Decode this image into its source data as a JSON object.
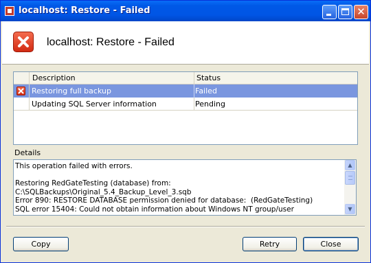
{
  "window": {
    "title": "localhost: Restore - Failed",
    "icon": "app-icon"
  },
  "header": {
    "title": "localhost: Restore - Failed",
    "icon": "error-icon"
  },
  "grid": {
    "columns": [
      "Description",
      "Status"
    ],
    "rows": [
      {
        "description": "Restoring full backup",
        "status": "Failed",
        "icon": "error-icon",
        "selected": true
      },
      {
        "description": "Updating SQL Server information",
        "status": "Pending",
        "icon": "",
        "selected": false
      }
    ]
  },
  "details": {
    "label": "Details",
    "lines": [
      "This operation failed with errors.",
      "",
      "Restoring RedGateTesting (database) from:",
      "C:\\SQLBackups\\Original_5.4_Backup_Level_3.sqb",
      "Error 890: RESTORE DATABASE permission denied for database:  (RedGateTesting)",
      "SQL error 15404: Could not obtain information about Windows NT group/user"
    ]
  },
  "buttons": {
    "copy": "Copy",
    "retry": "Retry",
    "close": "Close"
  },
  "colors": {
    "titlebar": "#0058e6",
    "selection": "#7a96df",
    "error": "#d22b13"
  }
}
